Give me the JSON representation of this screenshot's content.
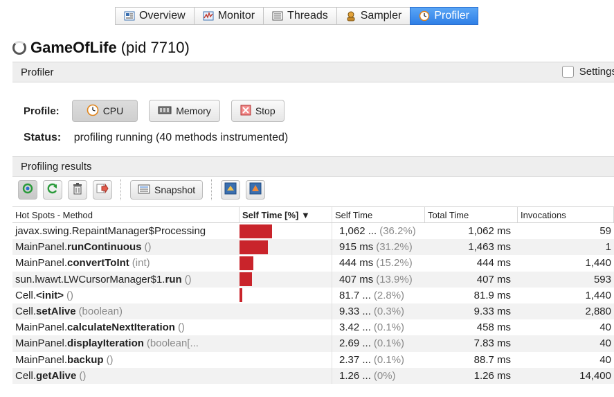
{
  "tabs": [
    {
      "label": "Overview",
      "icon": "overview-icon",
      "active": false
    },
    {
      "label": "Monitor",
      "icon": "monitor-icon",
      "active": false
    },
    {
      "label": "Threads",
      "icon": "threads-icon",
      "active": false
    },
    {
      "label": "Sampler",
      "icon": "sampler-icon",
      "active": false
    },
    {
      "label": "Profiler",
      "icon": "profiler-icon",
      "active": true
    }
  ],
  "app": {
    "name": "GameOfLife",
    "pid": "(pid 7710)"
  },
  "profiler_section": {
    "title": "Profiler",
    "settings_label": "Settings"
  },
  "profile": {
    "label": "Profile:",
    "cpu_label": "CPU",
    "memory_label": "Memory",
    "stop_label": "Stop"
  },
  "status": {
    "label": "Status:",
    "text": "profiling running (40 methods instrumented)"
  },
  "results_section": {
    "title": "Profiling results"
  },
  "toolbar": {
    "snapshot_label": "Snapshot"
  },
  "table": {
    "columns": [
      "Hot Spots - Method",
      "Self Time [%] ▼",
      "Self Time",
      "Total Time",
      "Invocations"
    ],
    "rows": [
      {
        "prefix": "javax.swing.RepaintManager$Processing",
        "bold": "",
        "args": "",
        "bar": 0.362,
        "self_time": "1,062 ...",
        "self_pct": "(36.2%)",
        "total": "1,062 ms",
        "invocations": "59"
      },
      {
        "prefix": "MainPanel.",
        "bold": "runContinuous",
        "args": "()",
        "bar": 0.312,
        "self_time": "915 ms",
        "self_pct": "(31.2%)",
        "total": "1,463 ms",
        "invocations": "1"
      },
      {
        "prefix": "MainPanel.",
        "bold": "convertToInt",
        "args": "(int)",
        "bar": 0.152,
        "self_time": "444 ms",
        "self_pct": "(15.2%)",
        "total": "444 ms",
        "invocations": "1,440"
      },
      {
        "prefix": "sun.lwawt.LWCursorManager$1.",
        "bold": "run",
        "args": "()",
        "bar": 0.139,
        "self_time": "407 ms",
        "self_pct": "(13.9%)",
        "total": "407 ms",
        "invocations": "593"
      },
      {
        "prefix": "Cell.",
        "bold": "<init>",
        "args": "()",
        "bar": 0.028,
        "self_time": "81.7 ...",
        "self_pct": "(2.8%)",
        "total": "81.9 ms",
        "invocations": "1,440"
      },
      {
        "prefix": "Cell.",
        "bold": "setAlive",
        "args": "(boolean)",
        "bar": 0.003,
        "self_time": "9.33 ...",
        "self_pct": "(0.3%)",
        "total": "9.33 ms",
        "invocations": "2,880"
      },
      {
        "prefix": "MainPanel.",
        "bold": "calculateNextIteration",
        "args": "()",
        "bar": 0.001,
        "self_time": "3.42 ...",
        "self_pct": "(0.1%)",
        "total": "458 ms",
        "invocations": "40"
      },
      {
        "prefix": "MainPanel.",
        "bold": "displayIteration",
        "args": "(boolean[...",
        "bar": 0.001,
        "self_time": "2.69 ...",
        "self_pct": "(0.1%)",
        "total": "7.83 ms",
        "invocations": "40"
      },
      {
        "prefix": "MainPanel.",
        "bold": "backup",
        "args": "()",
        "bar": 0.001,
        "self_time": "2.37 ...",
        "self_pct": "(0.1%)",
        "total": "88.7 ms",
        "invocations": "40"
      },
      {
        "prefix": "Cell.",
        "bold": "getAlive",
        "args": "()",
        "bar": 0.0,
        "self_time": "1.26 ...",
        "self_pct": "(0%)",
        "total": "1.26 ms",
        "invocations": "14,400"
      }
    ]
  },
  "colors": {
    "accent": "#2f7fe6",
    "bar": "#c9242b"
  }
}
